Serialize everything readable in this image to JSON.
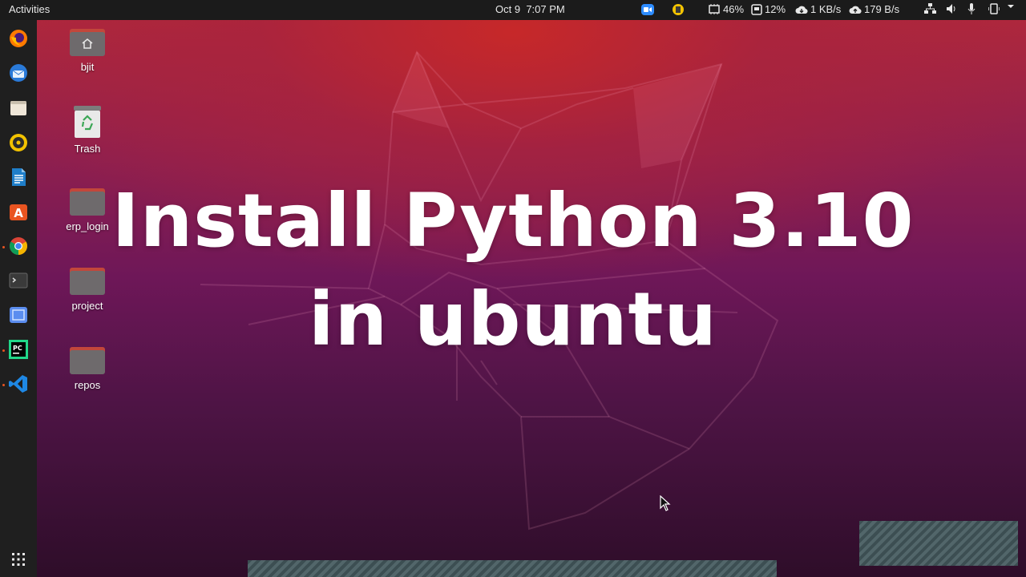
{
  "topbar": {
    "activities": "Activities",
    "date": "Oct 9",
    "time": "7:07 PM",
    "cpu": "46%",
    "disk": "12%",
    "net_down": "1 KB/s",
    "net_up": "179 B/s"
  },
  "desktop_icons": [
    {
      "label": "bjit"
    },
    {
      "label": "Trash"
    },
    {
      "label": "erp_login"
    },
    {
      "label": "project"
    },
    {
      "label": "repos"
    }
  ],
  "headline": {
    "line1": "Install Python 3.10",
    "line2": "in ubuntu"
  },
  "colors": {
    "accent": "#e95420",
    "topbar_bg": "#1b1b1b",
    "dock_bg": "#1f1f1f",
    "folder_tab": "#c2473b",
    "folder_body": "#6e6a6c"
  },
  "dock": {
    "apps": [
      "firefox-icon",
      "thunderbird-icon",
      "files-icon",
      "rhythmbox-icon",
      "writer-icon",
      "software-icon",
      "chrome-icon",
      "terminal-icon",
      "screenshot-icon",
      "pycharm-icon",
      "vscode-icon"
    ],
    "show_apps": "show-applications-icon"
  }
}
